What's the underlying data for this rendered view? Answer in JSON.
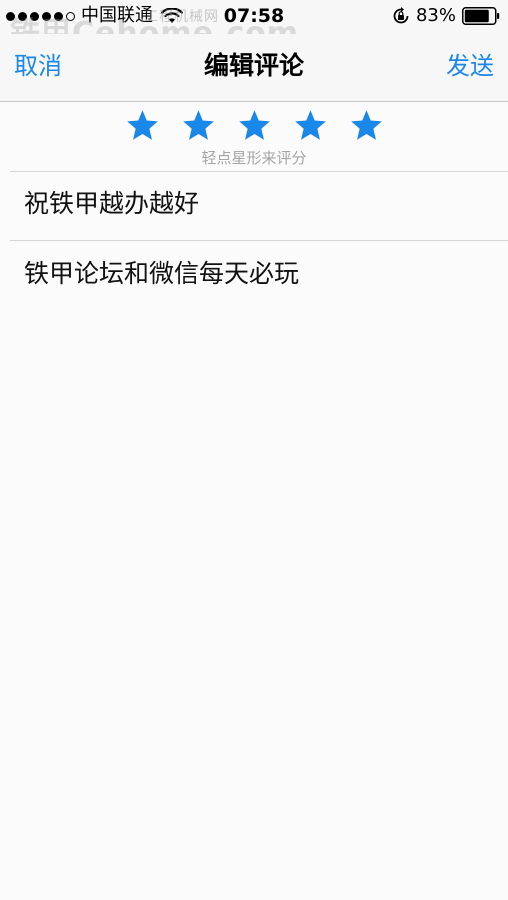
{
  "status_bar": {
    "carrier": "中国联通",
    "time": "07:58",
    "battery_percent": "83%",
    "signal_bars_filled": 5,
    "signal_bars_total": 6
  },
  "watermark": {
    "brand": "铁甲Cehome.com",
    "tagline": "工程机械网"
  },
  "nav": {
    "cancel_label": "取消",
    "title": "编辑评论",
    "send_label": "发送"
  },
  "rating": {
    "value": 5,
    "max": 5,
    "hint": "轻点星形来评分",
    "star_color": "#1a87ea"
  },
  "review": {
    "title": "祝铁甲越办越好",
    "body": "铁甲论坛和微信每天必玩"
  },
  "colors": {
    "accent": "#1a87ea",
    "hint_gray": "#a5a5a5",
    "divider": "#d5d5d5"
  }
}
